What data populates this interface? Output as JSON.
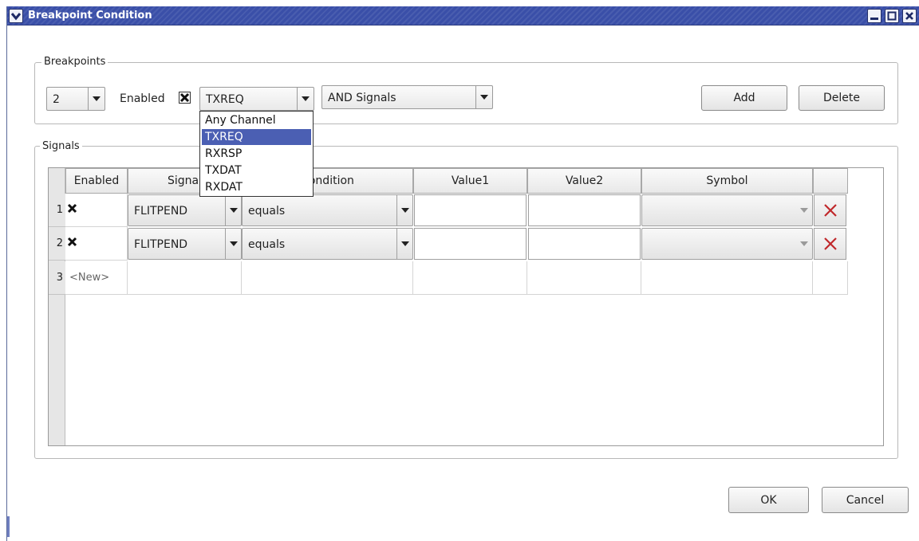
{
  "window": {
    "title": "Breakpoint Condition"
  },
  "breakpoints": {
    "group_title": "Breakpoints",
    "number_value": "2",
    "enabled_label": "Enabled",
    "enabled_checked": true,
    "channel_value": "TXREQ",
    "channel_options": [
      "Any Channel",
      "TXREQ",
      "RXRSP",
      "TXDAT",
      "RXDAT"
    ],
    "channel_selected_index": 1,
    "logic_value": "AND Signals",
    "add_label": "Add",
    "delete_label": "Delete"
  },
  "signals": {
    "group_title": "Signals",
    "columns": [
      "Enabled",
      "Signal",
      "Condition",
      "Value1",
      "Value2",
      "Symbol"
    ],
    "rows": [
      {
        "num": "1",
        "enabled": true,
        "signal": "FLITPEND",
        "condition": "equals",
        "value1": "",
        "value2": "",
        "symbol": ""
      },
      {
        "num": "2",
        "enabled": true,
        "signal": "FLITPEND",
        "condition": "equals",
        "value1": "",
        "value2": "",
        "symbol": ""
      }
    ],
    "new_row": {
      "num": "3",
      "label": "<New>"
    }
  },
  "footer": {
    "ok_label": "OK",
    "cancel_label": "Cancel"
  },
  "colors": {
    "titlebar": "#3a4fa8",
    "selection": "#4b5fb3",
    "delete_icon": "#c0282b"
  }
}
